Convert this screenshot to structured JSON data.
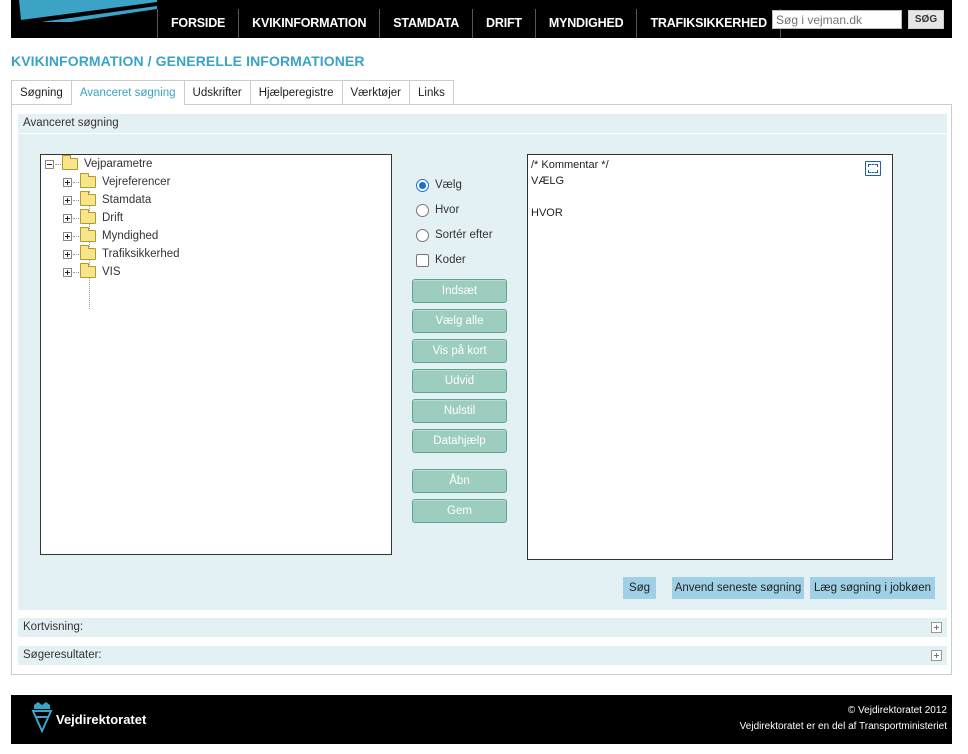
{
  "header": {
    "nav": [
      "FORSIDE",
      "KVIKINFORMATION",
      "STAMDATA",
      "DRIFT",
      "MYNDIGHED",
      "TRAFIKSIKKERHED"
    ],
    "search_placeholder": "Søg i vejman.dk",
    "search_button": "SØG"
  },
  "page_title": "KVIKINFORMATION / GENERELLE INFORMATIONER",
  "tabs": [
    "Søgning",
    "Avanceret søgning",
    "Udskrifter",
    "Hjælperegistre",
    "Værktøjer",
    "Links"
  ],
  "active_tab": "Avanceret søgning",
  "advanced": {
    "heading": "Avanceret søgning",
    "tree_root": "Vejparametre",
    "tree_items": [
      "Vejreferencer",
      "Stamdata",
      "Drift",
      "Myndighed",
      "Trafiksikkerhed",
      "VIS"
    ],
    "options": {
      "select": "Vælg",
      "where": "Hvor",
      "sort": "Sortér efter",
      "codes": "Koder"
    },
    "buttons": {
      "insert": "Indsæt",
      "select_all": "Vælg alle",
      "show_map": "Vis på kort",
      "expand": "Udvid",
      "reset": "Nulstil",
      "data_help": "Datahjælp",
      "open": "Åbn",
      "save": "Gem"
    },
    "editor_lines": [
      "/* Kommentar */",
      "VÆLG",
      "",
      "HVOR"
    ],
    "bottom_buttons": {
      "search": "Søg",
      "apply_last": "Anvend seneste søgning",
      "queue": "Læg søgning i jobkøen"
    }
  },
  "sections": {
    "map": "Kortvisning:",
    "results": "Søgeresultater:"
  },
  "footer": {
    "brand": "Vejdirektoratet",
    "copyright": "© Vejdirektoratet 2012",
    "subtitle": "Vejdirektoratet er en del af Transportministeriet"
  }
}
